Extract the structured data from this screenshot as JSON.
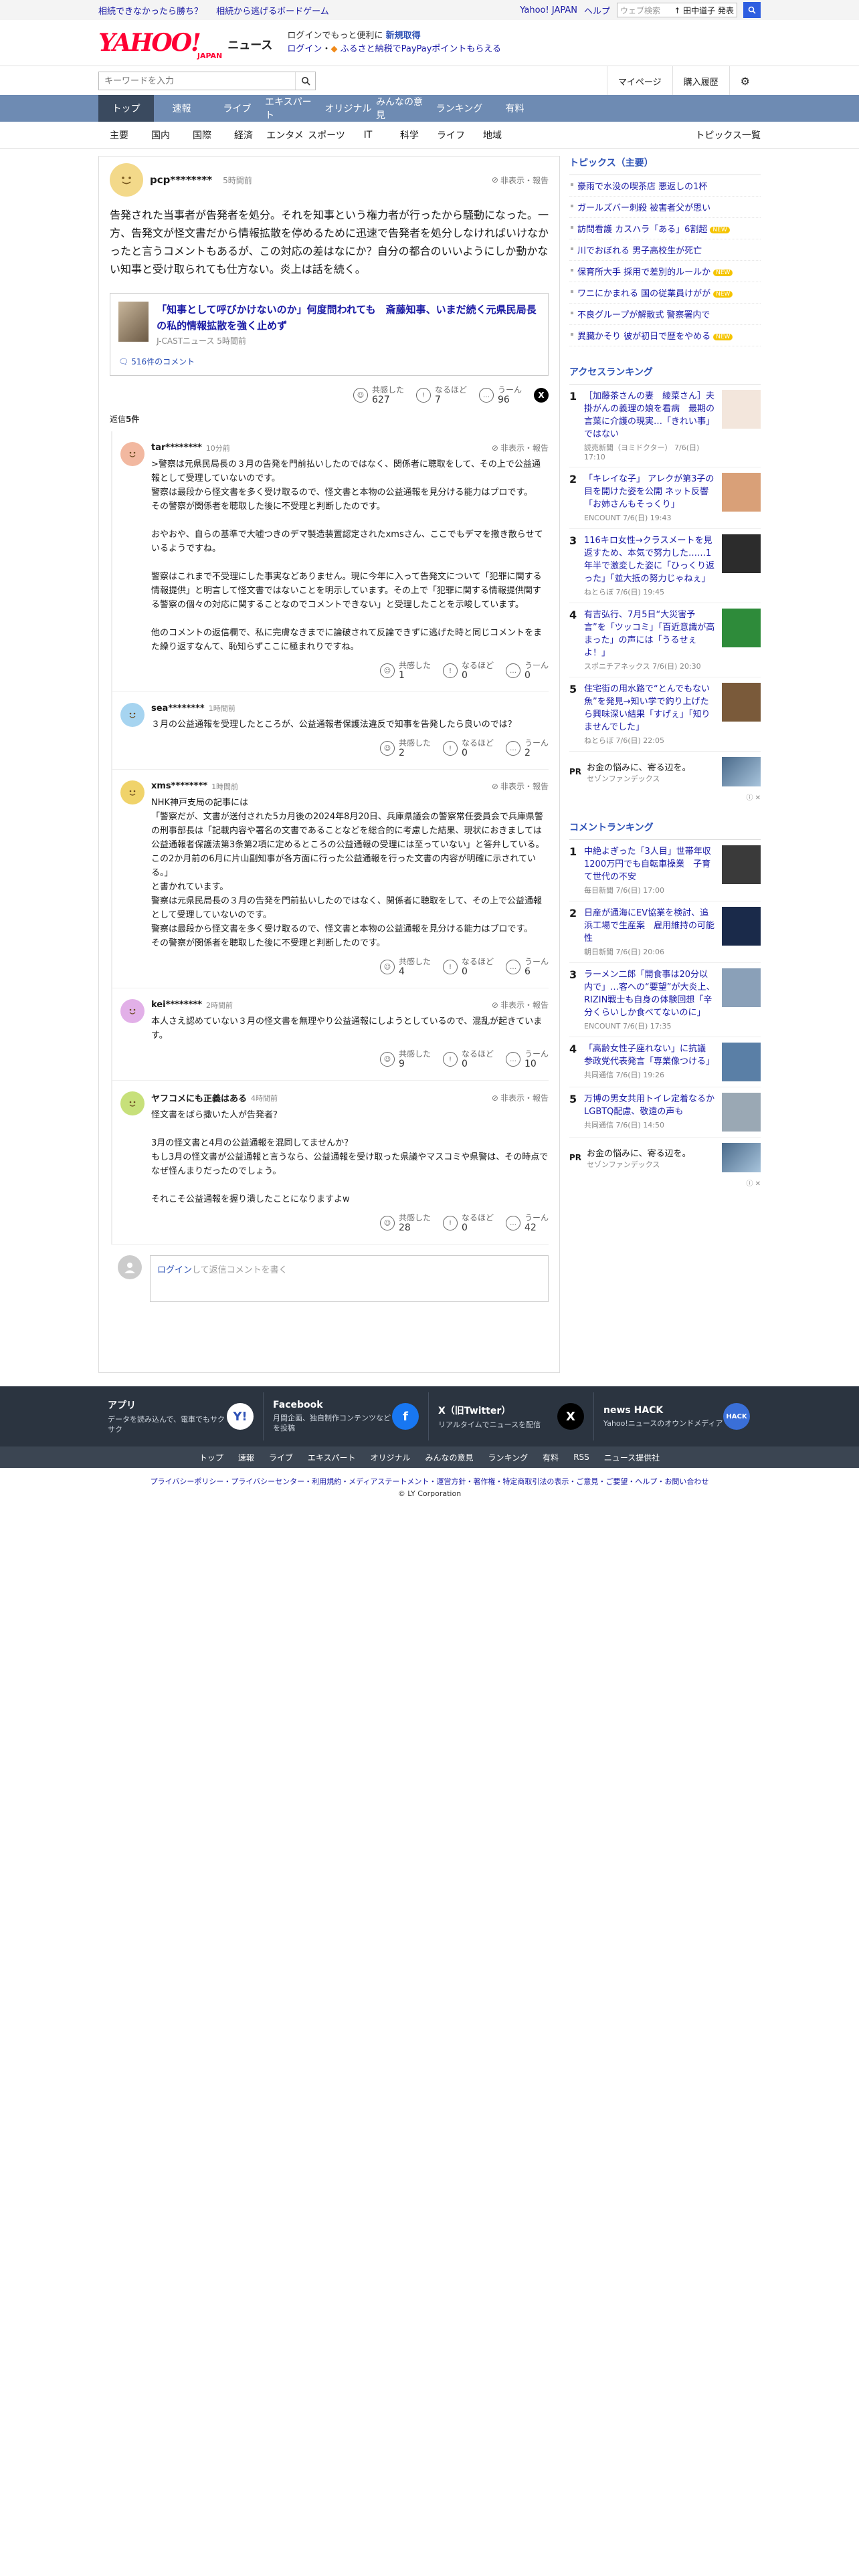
{
  "topbar": {
    "links": [
      "相続できなかったら勝ち？",
      "相続から逃げるボードゲーム"
    ],
    "right_links": [
      "Yahoo! JAPAN",
      "ヘルプ"
    ],
    "search_placeholder": "ウェブ検索",
    "search_keyword": "↑ 田中道子 発表"
  },
  "header": {
    "logo_main": "YAHOO!",
    "logo_sub": "JAPAN",
    "logo_news": "ニュース",
    "msg_line1_a": "ログインでもっと便利に",
    "msg_line1_b": "新規取得",
    "msg_line2_a": "ログイン",
    "msg_line2_b": "ふるさと納税でPayPayポイントもらえる"
  },
  "search": {
    "placeholder": "キーワードを入力",
    "links": [
      "マイページ",
      "購入履歴"
    ]
  },
  "gnav": [
    "トップ",
    "速報",
    "ライブ",
    "エキスパート",
    "オリジナル",
    "みんなの意見",
    "ランキング",
    "有料"
  ],
  "subnav": [
    "主要",
    "国内",
    "国際",
    "経済",
    "エンタメ",
    "スポーツ",
    "IT",
    "科学",
    "ライフ",
    "地域"
  ],
  "subnav_last": "トピックス一覧",
  "parent": {
    "name": "pcp********",
    "time": "5時間前",
    "report": "非表示・報告",
    "text": "告発された当事者が告発者を処分。それを知事という権力者が行ったから騒動になった。一方、告発文が怪文書だから情報拡散を停めるために迅速で告発者を処分しなければいけなかったと言うコメントもあるが、この対応の差はなにか？自分の都合のいいようにしか動かない知事と受け取られても仕方ない。炎上は話を続く。",
    "article_title": "「知事として呼びかけないのか」何度問われても　斎藤知事、いまだ続く元県民局長の私的情報拡散を強く止めず",
    "article_src": "J-CASTニュース 5時間前",
    "article_comments": "516件のコメント",
    "reacts": [
      {
        "label": "共感した",
        "num": "627"
      },
      {
        "label": "なるほど",
        "num": "7"
      },
      {
        "label": "うーん",
        "num": "96"
      }
    ],
    "reply_count_label": "返信",
    "reply_count": "5件"
  },
  "replies": [
    {
      "name": "tar********",
      "time": "10分前",
      "report": "非表示・報告",
      "text": ">警察は元県民局長の３月の告発を門前払いしたのではなく、関係者に聴取をして、その上で公益通報として受理していないのです。\n警察は最段から怪文書を多く受け取るので、怪文書と本物の公益通報を見分ける能力はプロです。\nその警察が関係者を聴取した後に不受理と判断したのです。\n\nおやおや、自らの基準で大嘘つきのデマ製造装置認定されたxmsさん、ここでもデマを撒き散らせているようですね。\n\n警察はこれまで不受理にした事実などありません。現に今年に入って告発文について「犯罪に関する情報提供」と明言して怪文書ではないことを明示しています。その上で「犯罪に関する情報提供関する警察の個々の対応に関することなのでコメントできない」と受理したことを示唆しています。\n\n他のコメントの返信欄で、私に完膚なきまでに論破されて反論できずに逃げた時と同じコメントをまた繰り返すなんて、恥知らずここに極まれりですね。",
      "reacts": [
        {
          "label": "共感した",
          "num": "1"
        },
        {
          "label": "なるほど",
          "num": "0"
        },
        {
          "label": "うーん",
          "num": "0"
        }
      ],
      "color": "#f2b8a0"
    },
    {
      "name": "sea********",
      "time": "1時間前",
      "report": "",
      "text": "３月の公益通報を受理したところが、公益通報者保護法違反で知事を告発したら良いのでは？",
      "reacts": [
        {
          "label": "共感した",
          "num": "2"
        },
        {
          "label": "なるほど",
          "num": "0"
        },
        {
          "label": "うーん",
          "num": "2"
        }
      ],
      "color": "#a6d4f0"
    },
    {
      "name": "xms********",
      "time": "1時間前",
      "report": "非表示・報告",
      "text": "NHK神戸支局の記事には\n「警察だが、文書が送付された5カ月後の2024年8月20日、兵庫県議会の警察常任委員会で兵庫県警の刑事部長は「記載内容や署名の文書であることなどを総合的に考慮した結果、現状におきましては公益通報者保護法第3条第2項に定めるところの公益通報の受理には至っていない」と答弁している。この2か月前の6月に片山副知事が各方面に行った公益通報を行った文書の内容が明確に示されている。」\nと書かれています。\n警察は元県民局長の３月の告発を門前払いしたのではなく、関係者に聴取をして、その上で公益通報として受理していないのです。\n警察は最段から怪文書を多く受け取るので、怪文書と本物の公益通報を見分ける能力はプロです。\nその警察が関係者を聴取した後に不受理と判断したのです。",
      "reacts": [
        {
          "label": "共感した",
          "num": "4"
        },
        {
          "label": "なるほど",
          "num": "0"
        },
        {
          "label": "うーん",
          "num": "6"
        }
      ],
      "color": "#f0d36a"
    },
    {
      "name": "kei********",
      "time": "2時間前",
      "report": "非表示・報告",
      "text": "本人さえ認めていない３月の怪文書を無理やり公益通報にしようとしているので、混乱が起きています。",
      "reacts": [
        {
          "label": "共感した",
          "num": "9"
        },
        {
          "label": "なるほど",
          "num": "0"
        },
        {
          "label": "うーん",
          "num": "10"
        }
      ],
      "color": "#e2b0e8"
    },
    {
      "name": "ヤフコメにも正義はある",
      "time": "4時間前",
      "report": "非表示・報告",
      "text": "怪文書をばら撒いた人が告発者？\n\n3月の怪文書と4月の公益通報を混同してませんか？\nもし3月の怪文書が公益通報と言うなら、公益通報を受け取った県議やマスコミや県警は、その時点でなぜ怪んまりだったのでしょう。\n\nそれこそ公益通報を握り潰したことになりますよw",
      "reacts": [
        {
          "label": "共感した",
          "num": "28"
        },
        {
          "label": "なるほど",
          "num": "0"
        },
        {
          "label": "うーん",
          "num": "42"
        }
      ],
      "color": "#c7e07a"
    }
  ],
  "reply_form": {
    "login": "ログイン",
    "text": "して返信コメントを書く"
  },
  "topics": {
    "title": "トピックス（主要）",
    "items": [
      {
        "text": "豪雨で水没の喫茶店 悪返しの1杯",
        "badge": ""
      },
      {
        "text": "ガールズバー刺殺 被害者父が思い",
        "badge": ""
      },
      {
        "text": "訪問看護 カスハラ「ある」6割超",
        "badge": "NEW"
      },
      {
        "text": "川でおぼれる 男子高校生が死亡",
        "badge": ""
      },
      {
        "text": "保育所大手 採用で差別的ルールか",
        "badge": "NEW"
      },
      {
        "text": "ワニにかまれる 国の従業員けがが",
        "badge": "NEW"
      },
      {
        "text": "不良グループが解散式 警察署内で",
        "badge": ""
      },
      {
        "text": "異臓かそり 彼が初日で歴をやめる",
        "badge": "NEW"
      }
    ]
  },
  "access_ranking": {
    "title": "アクセスランキング",
    "items": [
      {
        "n": "1",
        "title": "［加藤茶さんの妻　綾菜さん］夫掛がんの義理の娘を看病　最期の言葉に介護の現実…「きれい事」ではない",
        "meta": "読売新聞（ヨミドクター） 7/6(日) 17:10",
        "color": "#f3e6dc"
      },
      {
        "n": "2",
        "title": "「キレイな子」 アレクが第3子の目を開けた姿を公開 ネット反響「お姉さんもそっくり」",
        "meta": "ENCOUNT 7/6(日) 19:43",
        "color": "#d9a078"
      },
      {
        "n": "3",
        "title": "116キロ女性→クラスメートを見返すため、本気で努力した……1年半で激変した姿に「ひっくり返った」「並大抵の努力じゃねぇ」",
        "meta": "ねとらぼ 7/6(日) 19:45",
        "color": "#2c2c2c"
      },
      {
        "n": "4",
        "title": "有吉弘行、7月5日“大災害予言”を「ツッコミ」「百近意識が高まった」の声には「うるせぇよ！」",
        "meta": "スポニチアネックス 7/6(日) 20:30",
        "color": "#2e8b3a"
      },
      {
        "n": "5",
        "title": "住宅街の用水路で“とんでもない魚”を発見→知い学で釣り上げたら興味深い結果「すげぇ」「知りませんでした」",
        "meta": "ねとらぼ 7/6(日) 22:05",
        "color": "#7a5a3a"
      }
    ],
    "pr": {
      "tag": "PR",
      "title": "お金の悩みに、寄る辺を。",
      "sponsor": "セゾンファンデックス"
    }
  },
  "comment_ranking": {
    "title": "コメントランキング",
    "items": [
      {
        "n": "1",
        "title": "中絶よぎった「3人目」世帯年収1200万円でも自転車操業　子育て世代の不安",
        "meta": "毎日新聞 7/6(日) 17:00",
        "color": "#3a3a3a"
      },
      {
        "n": "2",
        "title": "日産が通海にEV協業を検討、追浜工場で生産案　雇用維持の可能性",
        "meta": "朝日新聞 7/6(日) 20:06",
        "color": "#1a2a4a"
      },
      {
        "n": "3",
        "title": "ラーメン二郎「開食事は20分以内で」…客への“要望”が大炎上、RIZIN戦士も自身の体験回想「辛分くらいしか食べてないのに」",
        "meta": "ENCOUNT 7/6(日) 17:35",
        "color": "#8aa0b8"
      },
      {
        "n": "4",
        "title": "「高齢女性子座れない」に抗議　参政党代表発言「専業像つける」",
        "meta": "共同通信 7/6(日) 19:26",
        "color": "#5a7fa6"
      },
      {
        "n": "5",
        "title": "万博の男女共用トイレ定着なるかLGBTQ配慮、敬遠の声も",
        "meta": "共同通信 7/6(日) 14:50",
        "color": "#9aa8b4"
      }
    ],
    "pr": {
      "tag": "PR",
      "title": "お金の悩みに、寄る辺を。",
      "sponsor": "セゾンファンデックス"
    }
  },
  "footer": {
    "cards": [
      {
        "h": "アプリ",
        "d": "データを読み込んで、電車でもサクサク",
        "ic": "Y!",
        "color": "#fff",
        "fg": "#2e52b6"
      },
      {
        "h": "Facebook",
        "d": "月間企画、独自制作コンテンツなどを投稿",
        "ic": "f",
        "color": "#1877f2",
        "fg": "#fff"
      },
      {
        "h": "X（旧Twitter）",
        "d": "リアルタイムでニュースを配信",
        "ic": "X",
        "color": "#000",
        "fg": "#fff"
      },
      {
        "h": "news HACK",
        "d": "Yahoo!ニュースのオウンドメディア",
        "ic": "HACK",
        "color": "#3a6fd8",
        "fg": "#fff"
      }
    ],
    "nav": [
      "トップ",
      "速報",
      "ライブ",
      "エキスパート",
      "オリジナル",
      "みんなの意見",
      "ランキング",
      "有料",
      "RSS",
      "ニュース提供社"
    ],
    "legal": "プライバシーポリシー・プライバシーセンター・利用規約・メディアステートメント・運営方針・著作権・特定商取引法の表示・ご意見・ご要望・ヘルプ・お問い合わせ",
    "copyright": "© LY Corporation"
  }
}
